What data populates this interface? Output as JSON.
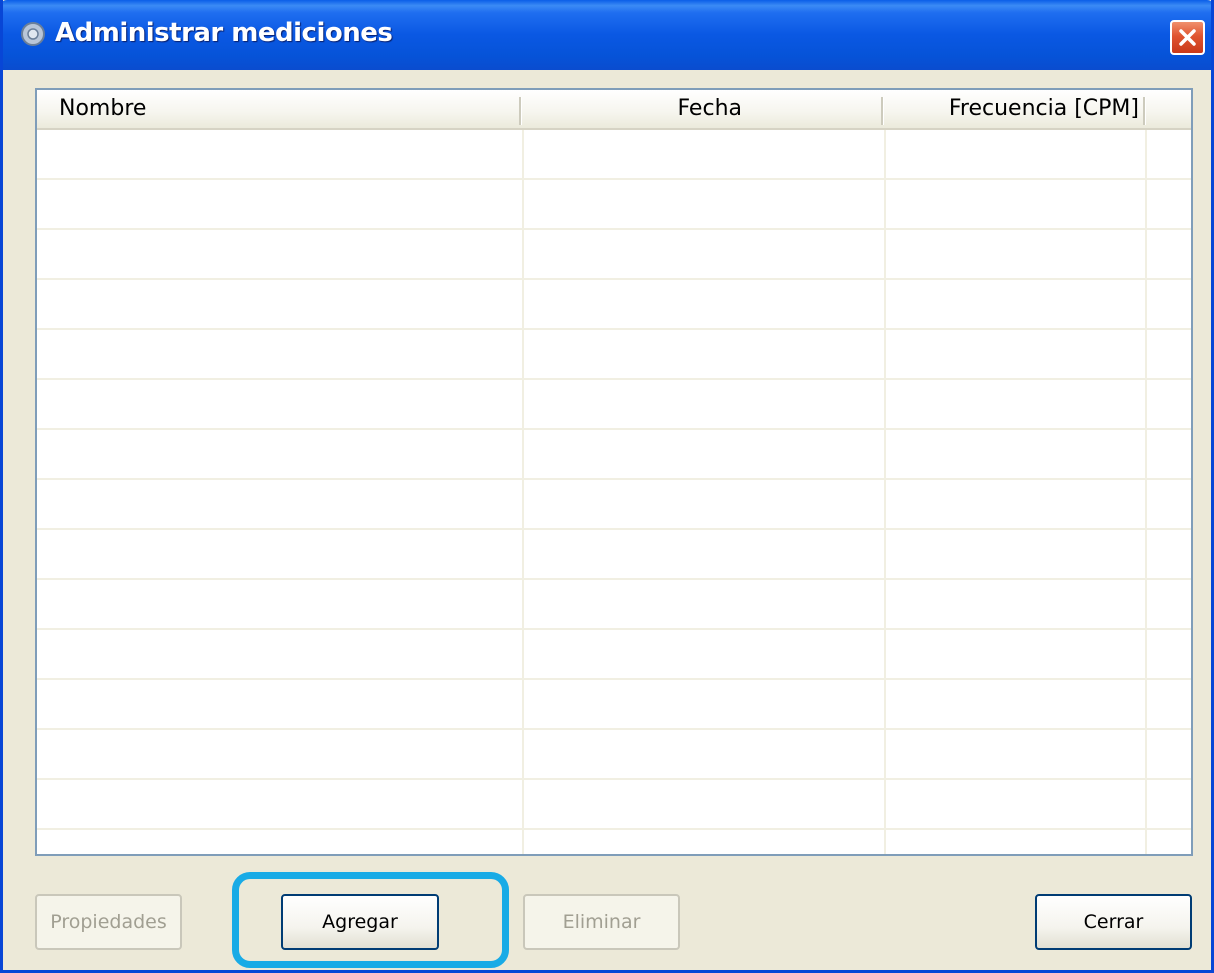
{
  "window": {
    "title": "Administrar mediciones",
    "icon": "gear-icon",
    "close_icon": "close-icon",
    "accent_color": "#0a58e3"
  },
  "list": {
    "columns": [
      "Nombre",
      "Fecha",
      "Frecuencia [CPM]"
    ],
    "rows": []
  },
  "buttons": {
    "properties": "Propiedades",
    "add": "Agregar",
    "delete": "Eliminar",
    "close": "Cerrar"
  },
  "highlight_color": "#19abe6"
}
